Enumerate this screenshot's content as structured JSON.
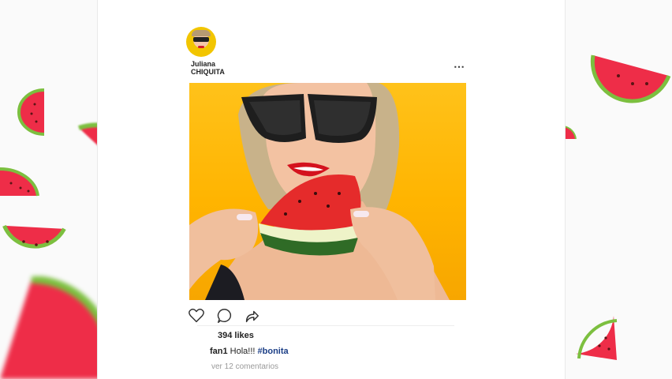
{
  "post": {
    "username_first": "Juliana",
    "username_last": "CHIQUITA",
    "more_icon": "⋯",
    "likes": "394 likes",
    "comment": {
      "user": "fan1",
      "text": " Hola!!! ",
      "hashtag": "#bonita"
    },
    "view_comments": "ver 12 comentarios"
  },
  "icons": [
    "heart-icon",
    "comment-icon",
    "share-icon",
    "more-options-icon"
  ],
  "colors": {
    "photo_background": "#ffb400",
    "watermelon_flesh": "#f0304a",
    "watermelon_rind": "#6fb53a",
    "hashtag": "#1b3e86"
  }
}
